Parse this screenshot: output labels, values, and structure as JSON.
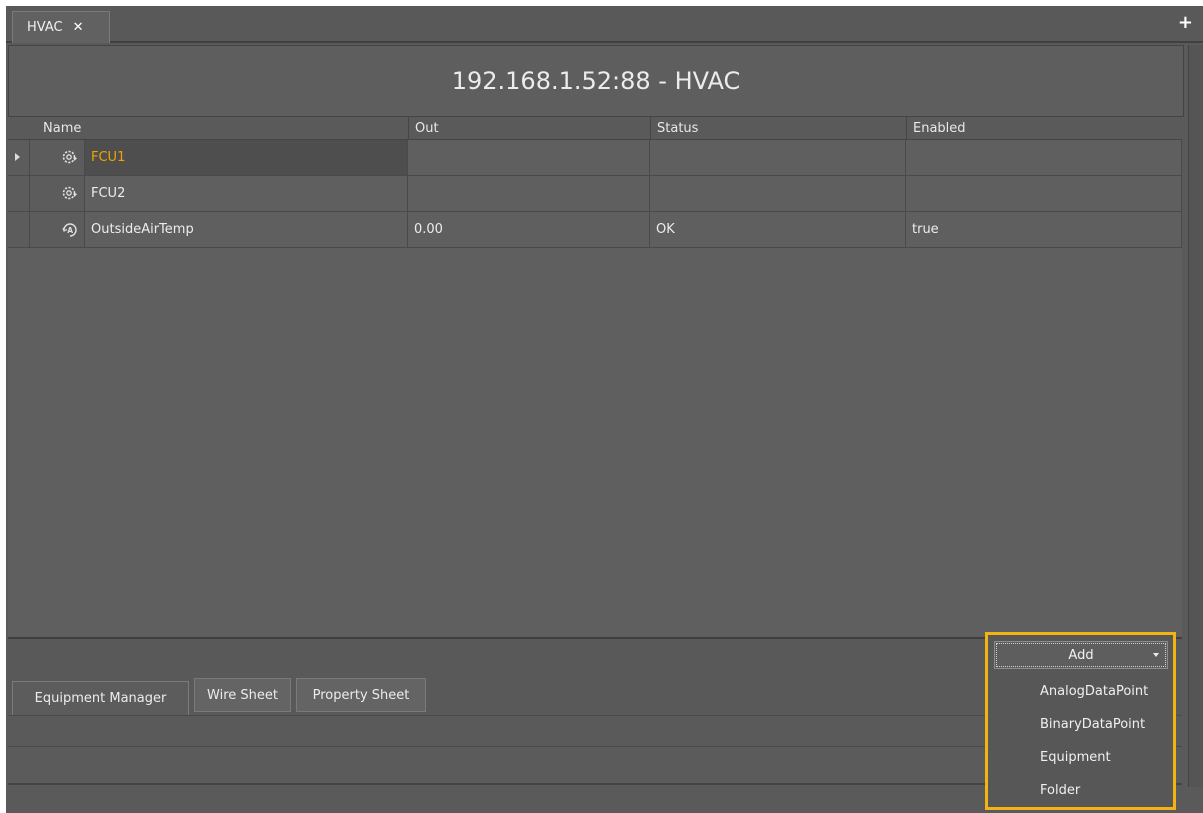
{
  "tab": {
    "title": "HVAC",
    "close": "✕",
    "new_tab": "+"
  },
  "header": {
    "title": "192.168.1.52:88 - HVAC"
  },
  "table": {
    "columns": [
      "Name",
      "Out",
      "Status",
      "Enabled"
    ],
    "rows": [
      {
        "name": "FCU1",
        "out": "",
        "status": "",
        "enabled": "",
        "icon": "equipment-gear-icon",
        "highlight": true
      },
      {
        "name": "FCU2",
        "out": "",
        "status": "",
        "enabled": "",
        "icon": "equipment-gear-icon",
        "highlight": false
      },
      {
        "name": "OutsideAirTemp",
        "out": "0.00",
        "status": "OK",
        "enabled": "true",
        "icon": "analog-point-icon",
        "highlight": false
      }
    ]
  },
  "view_tabs": [
    "Equipment Manager",
    "Wire Sheet",
    "Property Sheet"
  ],
  "add_menu": {
    "label": "Add",
    "items": [
      "AnalogDataPoint",
      "BinaryDataPoint",
      "Equipment",
      "Folder"
    ]
  },
  "colors": {
    "highlight_text": "#f0a400",
    "callout_border": "#f3b312",
    "background": "#5a5a5a"
  }
}
